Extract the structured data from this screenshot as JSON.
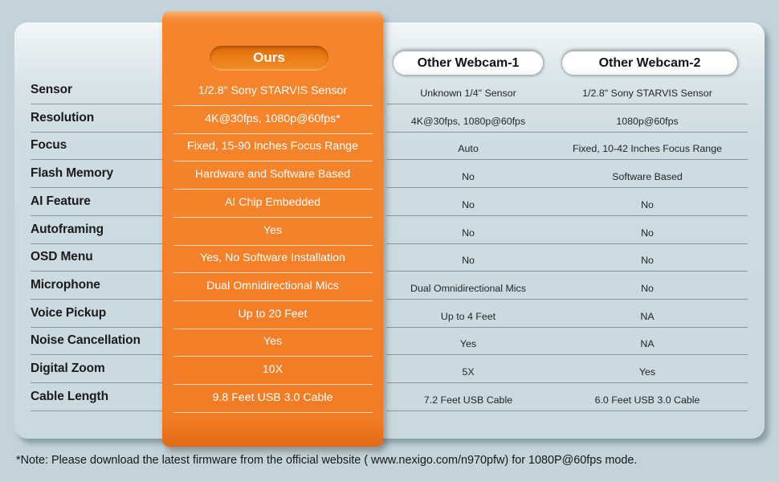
{
  "background_color": "#c3d3da",
  "card": {
    "accent_color": "#f4812a",
    "surface_color": "#cedde3"
  },
  "columns": {
    "feature_label": "",
    "ours": {
      "badge_label": "Ours",
      "badge_color": "#e07a14"
    },
    "other1": {
      "header": "Other Webcam-1"
    },
    "other2": {
      "header": "Other Webcam-2"
    }
  },
  "rows": [
    {
      "label": "Sensor",
      "ours": "1/2.8\" Sony STARVIS Sensor",
      "other1": "Unknown 1/4\" Sensor",
      "other2": "1/2.8\" Sony STARVIS Sensor"
    },
    {
      "label": "Resolution",
      "ours": "4K@30fps, 1080p@60fps*",
      "other1": "4K@30fps, 1080p@60fps",
      "other2": "1080p@60fps"
    },
    {
      "label": "Focus",
      "ours": "Fixed, 15-90 Inches Focus Range",
      "other1": "Auto",
      "other2": "Fixed, 10-42 Inches Focus Range"
    },
    {
      "label": "Flash Memory",
      "ours": "Hardware and Software Based",
      "other1": "No",
      "other2": "Software Based"
    },
    {
      "label": "AI Feature",
      "ours": "AI Chip Embedded",
      "other1": "No",
      "other2": "No"
    },
    {
      "label": "Autoframing",
      "ours": "Yes",
      "other1": "No",
      "other2": "No"
    },
    {
      "label": "OSD Menu",
      "ours": "Yes, No Software Installation",
      "other1": "No",
      "other2": "No"
    },
    {
      "label": "Microphone",
      "ours": "Dual Omnidirectional Mics",
      "other1": "Dual Omnidirectional Mics",
      "other2": "No"
    },
    {
      "label": "Voice Pickup",
      "ours": "Up to 20 Feet",
      "other1": "Up to 4 Feet",
      "other2": "NA"
    },
    {
      "label": "Noise Cancellation",
      "ours": "Yes",
      "other1": "Yes",
      "other2": "NA"
    },
    {
      "label": "Digital Zoom",
      "ours": "10X",
      "other1": "5X",
      "other2": "Yes"
    },
    {
      "label": "Cable Length",
      "ours": "9.8 Feet USB 3.0 Cable",
      "other1": "7.2 Feet USB Cable",
      "other2": "6.0 Feet USB 3.0 Cable"
    }
  ],
  "footer": {
    "note": "*Note: Please download the latest firmware from the official website ( www.nexigo.com/n970pfw) for 1080P@60fps mode."
  }
}
